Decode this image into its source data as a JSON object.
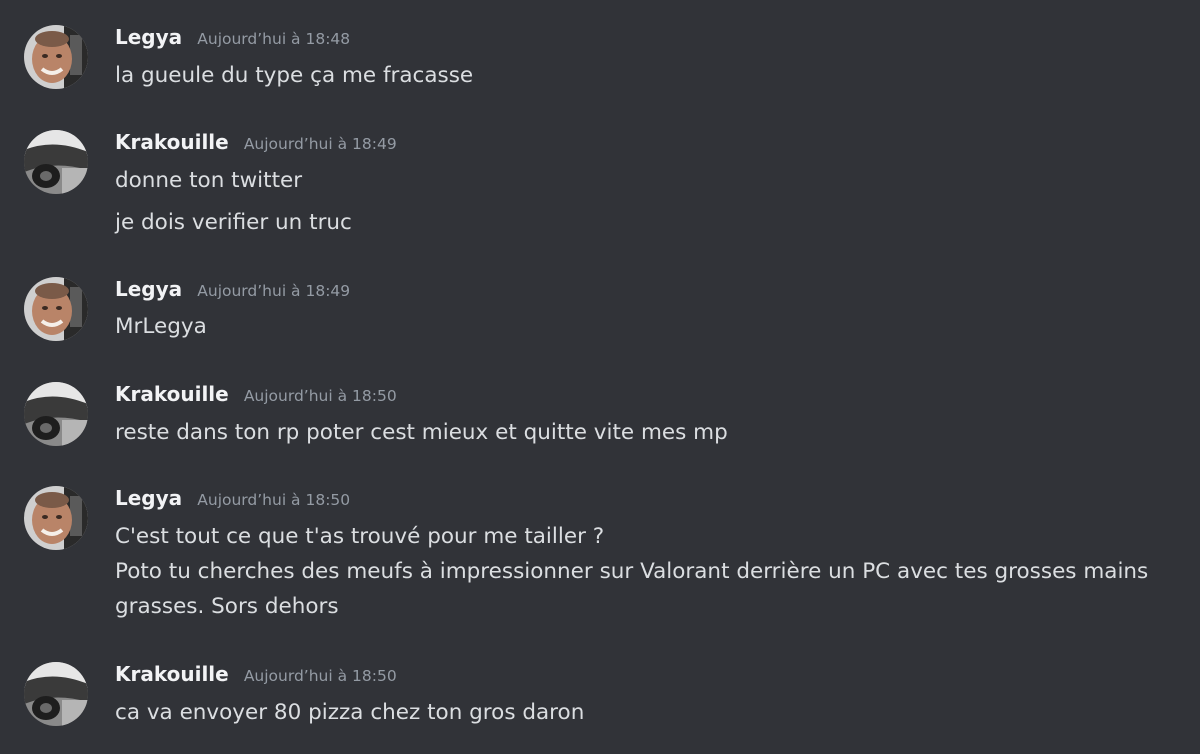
{
  "messages": [
    {
      "author": "Legya",
      "timestamp": "Aujourd’hui à 18:48",
      "avatar_icon": "legya-avatar",
      "lines": [
        "la gueule du type ça me fracasse"
      ]
    },
    {
      "author": "Krakouille",
      "timestamp": "Aujourd’hui à 18:49",
      "avatar_icon": "krakouille-avatar",
      "lines": [
        "donne ton twitter",
        "je dois verifier un truc"
      ]
    },
    {
      "author": "Legya",
      "timestamp": "Aujourd’hui à 18:49",
      "avatar_icon": "legya-avatar",
      "lines": [
        "MrLegya"
      ]
    },
    {
      "author": "Krakouille",
      "timestamp": "Aujourd’hui à 18:50",
      "avatar_icon": "krakouille-avatar",
      "lines": [
        "reste dans ton rp poter cest mieux et quitte vite mes mp"
      ]
    },
    {
      "author": "Legya",
      "timestamp": "Aujourd’hui à 18:50",
      "avatar_icon": "legya-avatar",
      "lines": [
        "C'est tout ce que t'as trouvé pour me tailler ?",
        "Poto tu cherches des meufs à impressionner sur Valorant derrière un PC avec tes grosses mains",
        "grasses. Sors dehors"
      ]
    },
    {
      "author": "Krakouille",
      "timestamp": "Aujourd’hui à 18:50",
      "avatar_icon": "krakouille-avatar",
      "lines": [
        "ca va envoyer 80 pizza chez ton gros daron"
      ]
    }
  ],
  "colors": {
    "background": "#313338",
    "username": "#f2f3f5",
    "timestamp": "#949ba4",
    "message_text": "#dbdee1"
  }
}
